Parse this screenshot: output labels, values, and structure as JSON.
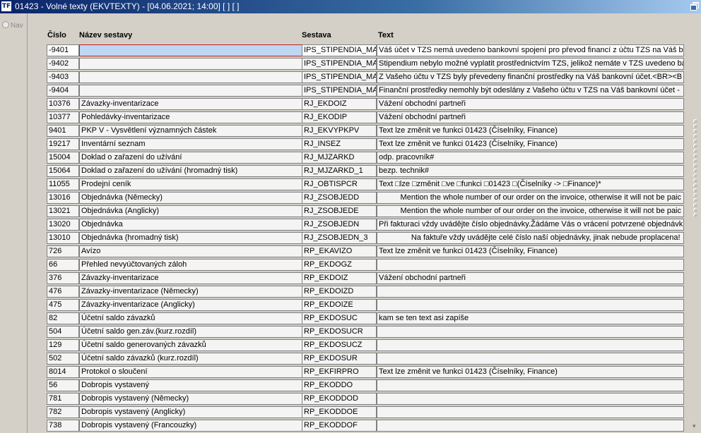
{
  "window": {
    "icon_label": "TF",
    "title": "01423 - Volné texty (EKVTEXTY) - [04.06.2021; 14:00]  [ ]  [ ]",
    "restore_icon": "restore-icon"
  },
  "nav": {
    "label": "Nav"
  },
  "table": {
    "headers": {
      "id": "Číslo",
      "name": "Název sestavy",
      "report": "Sestava",
      "text": "Text"
    },
    "rows": [
      {
        "id": "-9401",
        "name": "",
        "report": "IPS_STIPENDIA_MAIL",
        "text": "Váš účet v TZS nemá uvedeno bankovní spojení pro převod financí z účtu TZS na Váš b"
      },
      {
        "id": "-9402",
        "name": "",
        "report": "IPS_STIPENDIA_MAIL",
        "text": "Stipendium nebylo možné vyplatit prostřednictvím TZS, jelikož nemáte v TZS uvedeno bar"
      },
      {
        "id": "-9403",
        "name": "",
        "report": "IPS_STIPENDIA_MAIL",
        "text": "Z Vašeho účtu v TZS byly převedeny finanční prostředky na Váš bankovní účet.<BR><B"
      },
      {
        "id": "-9404",
        "name": "",
        "report": "IPS_STIPENDIA_MAIL",
        "text": "Finanční prostředky nemohly být odeslány z Vašeho účtu v TZS na Váš bankovní účet -"
      },
      {
        "id": "10376",
        "name": "Závazky-inventarizace",
        "report": "RJ_EKDOIZ",
        "text": "Vážení obchodní partneři"
      },
      {
        "id": "10377",
        "name": "Pohledávky-inventarizace",
        "report": "RJ_EKODIP",
        "text": "Vážení obchodní partneři"
      },
      {
        "id": "9401",
        "name": "PKP V - Vysvětlení významných částek",
        "report": "RJ_EKVYPKPV",
        "text": "Text lze změnit ve funkci 01423 (Číselníky, Finance)"
      },
      {
        "id": "19217",
        "name": "Inventární seznam",
        "report": "RJ_INSEZ",
        "text": "Text lze změnit ve funkci 01423 (Číselníky, Finance)"
      },
      {
        "id": "15004",
        "name": "Doklad o zařazení do užívání",
        "report": "RJ_MJZARKD",
        "text": "odp. pracovník#"
      },
      {
        "id": "15064",
        "name": "Doklad o zařazení do užívání (hromadný tisk)",
        "report": "RJ_MJZARKD_1",
        "text": "bezp. technik#"
      },
      {
        "id": "11055",
        "name": "Prodejní ceník",
        "report": "RJ_OBTISPCR",
        "text": "Text □lze □změnit □ve □funkci □01423 □(Číselníky -> □Finance)*"
      },
      {
        "id": "13016",
        "name": "Objednávka (Německy)",
        "report": "RJ_ZSOBJEDD",
        "text": "          Mention the whole number of our order on the invoice, otherwise it will not be paic"
      },
      {
        "id": "13021",
        "name": "Objednávka (Anglicky)",
        "report": "RJ_ZSOBJEDE",
        "text": "          Mention the whole number of our order on the invoice, otherwise it will not be paic"
      },
      {
        "id": "13020",
        "name": "Objednávka",
        "report": "RJ_ZSOBJEDN",
        "text": "Při fakturaci vždy uvádějte číslo objednávky.Žádáme Vás o vrácení potvrzené objednávk"
      },
      {
        "id": "13010",
        "name": "Objednávka  (hromadný tisk)",
        "report": "RJ_ZSOBJEDN_3",
        "text": "               Na faktuře vždy uvádějte celé číslo naší objednávky, jinak nebude proplacena!"
      },
      {
        "id": "726",
        "name": "Avízo",
        "report": "RP_EKAVIZO",
        "text": "Text lze změnit ve funkci 01423 (Číselníky, Finance)"
      },
      {
        "id": "66",
        "name": "Přehled nevyúčtovaných záloh",
        "report": "RP_EKDOGZ",
        "text": ""
      },
      {
        "id": "376",
        "name": "Závazky-inventarizace",
        "report": "RP_EKDOIZ",
        "text": "Vážení obchodní partneři"
      },
      {
        "id": "476",
        "name": "Závazky-inventarizace (Německy)",
        "report": "RP_EKDOIZD",
        "text": ""
      },
      {
        "id": "475",
        "name": "Závazky-inventarizace (Anglicky)",
        "report": "RP_EKDOIZE",
        "text": ""
      },
      {
        "id": "82",
        "name": "Účetní saldo závazků",
        "report": "RP_EKDOSUC",
        "text": "kam se ten text asi zapíše"
      },
      {
        "id": "504",
        "name": "Účetní saldo gen.záv.(kurz.rozdíl)",
        "report": "RP_EKDOSUCR",
        "text": ""
      },
      {
        "id": "129",
        "name": "Účetní saldo generovaných závazků",
        "report": "RP_EKDOSUCZ",
        "text": ""
      },
      {
        "id": "502",
        "name": "Účetní saldo závazků (kurz.rozdíl)",
        "report": "RP_EKDOSUR",
        "text": ""
      },
      {
        "id": "8014",
        "name": "Protokol o sloučení",
        "report": "RP_EKFIRPRO",
        "text": "Text lze změnit ve funkci 01423 (Číselníky, Finance)"
      },
      {
        "id": "56",
        "name": "Dobropis vystavený",
        "report": "RP_EKODDO",
        "text": ""
      },
      {
        "id": "781",
        "name": "Dobropis vystavený (Německy)",
        "report": "RP_EKODDOD",
        "text": ""
      },
      {
        "id": "782",
        "name": "Dobropis vystavený (Anglicky)",
        "report": "RP_EKODDOE",
        "text": ""
      },
      {
        "id": "738",
        "name": "Dobropis vystavený (Francouzky)",
        "report": "RP_EKODDOF",
        "text": ""
      }
    ]
  }
}
